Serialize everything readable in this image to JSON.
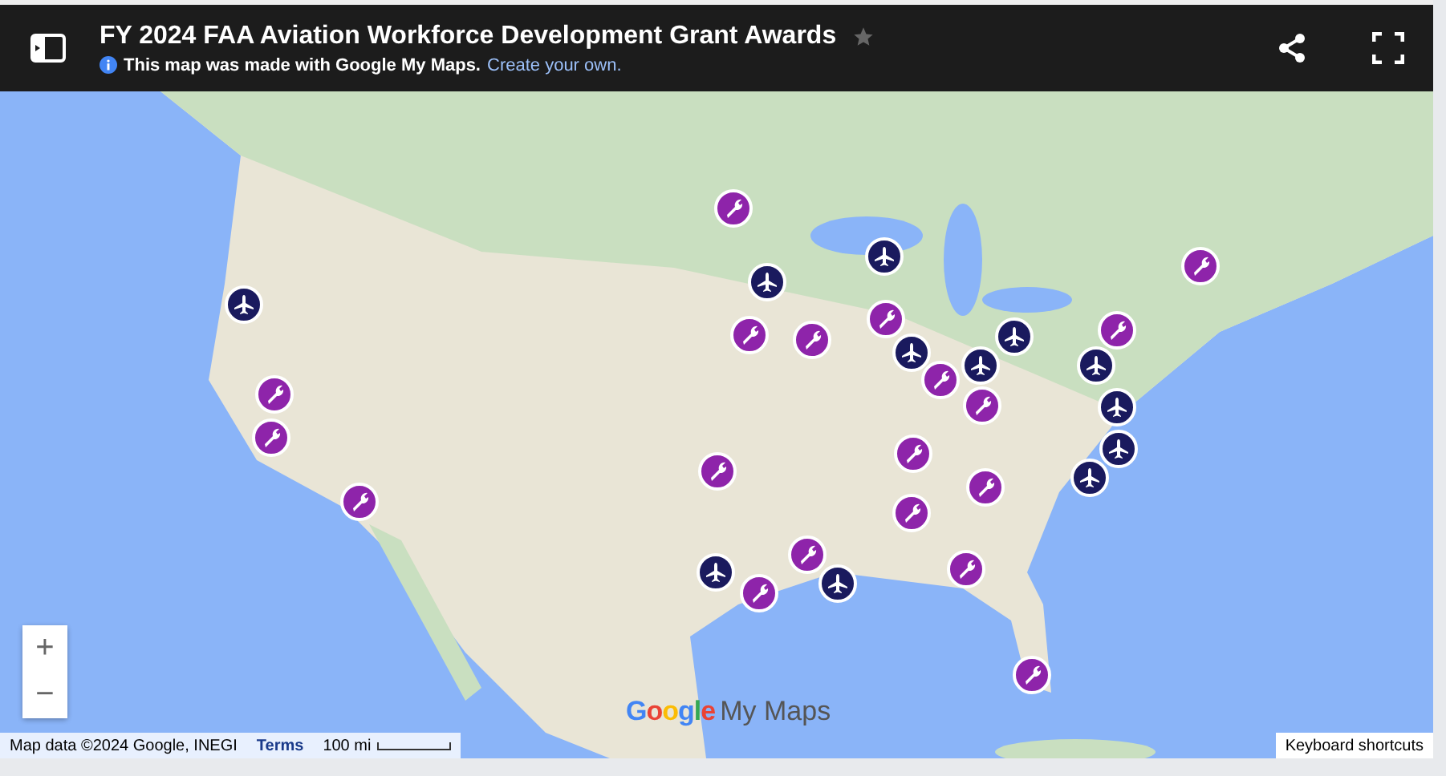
{
  "header": {
    "title": "FY 2024 FAA Aviation Workforce Development Grant Awards",
    "subtitle": "This map was made with Google My Maps.",
    "link": "Create your own."
  },
  "map": {
    "logo_brand": "Google",
    "logo_product": "My Maps",
    "attribution": "Map data ©2024 Google, INEGI",
    "terms": "Terms",
    "scale": "100 mi",
    "shortcuts": "Keyboard shortcuts",
    "zoom_in": "+",
    "zoom_out": "−"
  },
  "pins": [
    {
      "kind": "wrench"
    },
    {
      "kind": "wrench"
    },
    {
      "kind": "wrench"
    },
    {
      "kind": "wrench"
    },
    {
      "kind": "wrench"
    },
    {
      "kind": "wrench"
    },
    {
      "kind": "wrench"
    },
    {
      "kind": "wrench"
    },
    {
      "kind": "wrench"
    },
    {
      "kind": "wrench"
    },
    {
      "kind": "wrench"
    },
    {
      "kind": "wrench"
    },
    {
      "kind": "wrench"
    },
    {
      "kind": "wrench"
    },
    {
      "kind": "wrench"
    },
    {
      "kind": "wrench"
    },
    {
      "kind": "wrench"
    },
    {
      "kind": "wrench"
    },
    {
      "kind": "wrench"
    },
    {
      "kind": "plane"
    },
    {
      "kind": "plane"
    },
    {
      "kind": "plane"
    },
    {
      "kind": "plane"
    },
    {
      "kind": "plane"
    },
    {
      "kind": "plane"
    },
    {
      "kind": "plane"
    },
    {
      "kind": "plane"
    },
    {
      "kind": "plane"
    },
    {
      "kind": "plane"
    },
    {
      "kind": "plane"
    },
    {
      "kind": "plane"
    }
  ]
}
